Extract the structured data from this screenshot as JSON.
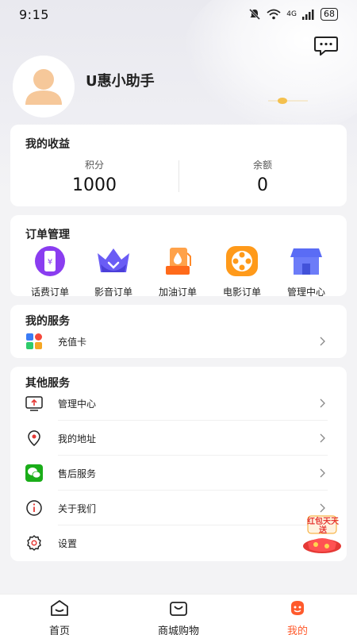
{
  "status_bar": {
    "time": "9:15",
    "network": "4G",
    "battery": "68"
  },
  "profile": {
    "username": "U惠小助手"
  },
  "earnings": {
    "title": "我的收益",
    "points_label": "积分",
    "points_value": "1000",
    "balance_label": "余额",
    "balance_value": "0"
  },
  "orders": {
    "title": "订单管理",
    "items": [
      {
        "label": "话费订单",
        "icon": "phone-bill-icon"
      },
      {
        "label": "影音订单",
        "icon": "crown-icon"
      },
      {
        "label": "加油订单",
        "icon": "fuel-icon"
      },
      {
        "label": "电影订单",
        "icon": "film-reel-icon"
      },
      {
        "label": "管理中心",
        "icon": "store-icon"
      }
    ]
  },
  "my_services": {
    "title": "我的服务",
    "items": [
      {
        "label": "充值卡",
        "icon": "grid-apps-icon"
      }
    ]
  },
  "other_services": {
    "title": "其他服务",
    "items": [
      {
        "label": "管理中心",
        "icon": "monitor-upload-icon"
      },
      {
        "label": "我的地址",
        "icon": "location-pin-icon"
      },
      {
        "label": "售后服务",
        "icon": "wechat-icon"
      },
      {
        "label": "关于我们",
        "icon": "info-icon"
      },
      {
        "label": "设置",
        "icon": "settings-gear-icon"
      }
    ]
  },
  "promo": {
    "text": "红包天天送"
  },
  "tabs": [
    {
      "label": "首页",
      "icon": "home-icon",
      "active": false
    },
    {
      "label": "商城购物",
      "icon": "shopping-bag-icon",
      "active": false
    },
    {
      "label": "我的",
      "icon": "profile-face-icon",
      "active": true
    }
  ],
  "colors": {
    "accent": "#ff5a2c",
    "background": "#f3f3f5",
    "card": "#ffffff"
  }
}
